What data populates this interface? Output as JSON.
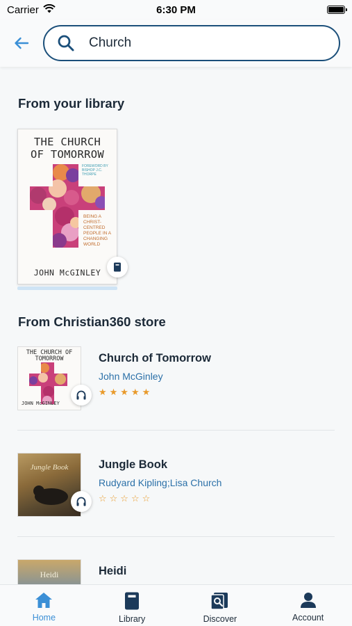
{
  "status_bar": {
    "carrier": "Carrier",
    "time": "6:30 PM"
  },
  "search": {
    "value": "Church",
    "placeholder": ""
  },
  "library": {
    "section_title": "From your library",
    "items": [
      {
        "cover_title_line1": "THE CHURCH",
        "cover_title_line2": "OF TOMORROW",
        "cover_author": "JOHN McGINLEY",
        "cover_subtitle": "BEING A CHRIST-CENTRED PEOPLE IN A CHANGING WORLD",
        "cover_foreword": "FOREWORD BY BISHOP J.C. THORPE",
        "format_icon": "book-icon"
      }
    ]
  },
  "store": {
    "section_title": "From Christian360 store",
    "items": [
      {
        "title": "Church of Tomorrow",
        "author": "John McGinley",
        "stars": "★★★★★",
        "cover_text_top": "THE CHURCH OF TOMORROW",
        "cover_text_author": "JOHN McGINLEY",
        "format_icon": "headphones-icon"
      },
      {
        "title": "Jungle Book",
        "author": "Rudyard Kipling;Lisa Church",
        "stars": "☆☆☆☆☆",
        "cover_text_top": "Jungle Book",
        "cover_text_author": "",
        "format_icon": "headphones-icon"
      },
      {
        "title": "Heidi",
        "author": "",
        "stars": "",
        "cover_text_top": "Heidi",
        "cover_text_author": "",
        "format_icon": ""
      }
    ]
  },
  "nav": {
    "items": [
      {
        "label": "Home",
        "icon": "home-icon",
        "active": true
      },
      {
        "label": "Library",
        "icon": "book-icon",
        "active": false
      },
      {
        "label": "Discover",
        "icon": "discover-icon",
        "active": false
      },
      {
        "label": "Account",
        "icon": "account-icon",
        "active": false
      }
    ]
  },
  "colors": {
    "accent": "#3b8fd6",
    "search_border": "#1b4f7a",
    "author_link": "#2b70a8",
    "star": "#e89a2b",
    "text_dark": "#1c2a38"
  }
}
